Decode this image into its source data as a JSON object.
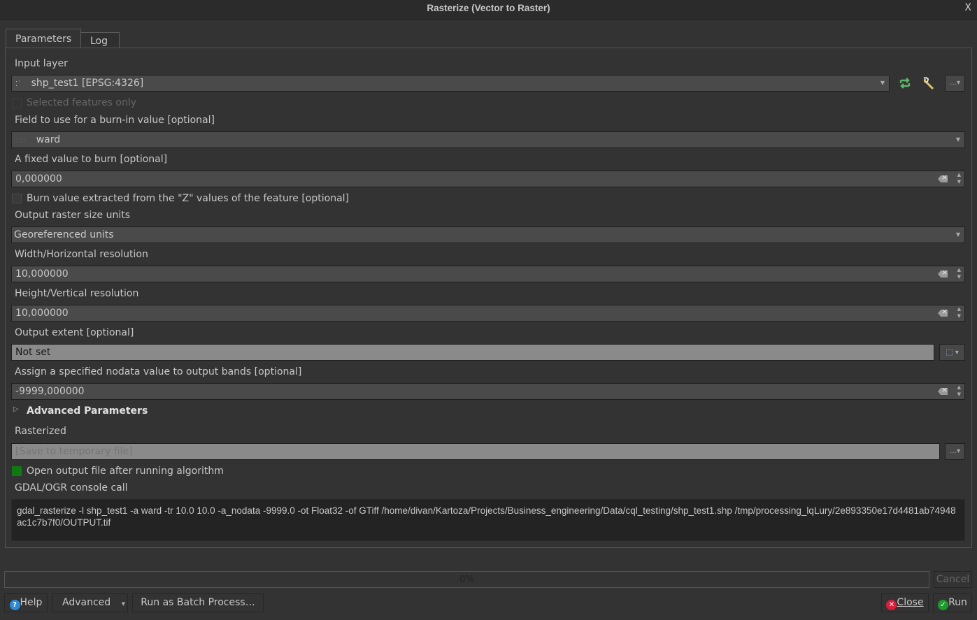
{
  "window": {
    "title": "Rasterize (Vector to Raster)",
    "close_label": "X"
  },
  "tabs": [
    {
      "label": "Parameters",
      "active": true
    },
    {
      "label": "Log",
      "active": false
    }
  ],
  "params": {
    "input_layer": {
      "label": "Input layer",
      "value": "shp_test1 [EPSG:4326]",
      "more_label": "…"
    },
    "selected_only": {
      "label": "Selected features only",
      "checked": false,
      "enabled": false
    },
    "burn_field": {
      "label": "Field to use for a burn-in value [optional]",
      "value": "ward",
      "type_badge": "123"
    },
    "fixed_value": {
      "label": "A fixed value to burn [optional]",
      "value": "0,000000"
    },
    "use_z": {
      "label": "Burn value extracted from the \"Z\" values of the feature [optional]",
      "checked": false
    },
    "units": {
      "label": "Output raster size units",
      "value": "Georeferenced units"
    },
    "width": {
      "label": "Width/Horizontal resolution",
      "value": "10,000000"
    },
    "height": {
      "label": "Height/Vertical resolution",
      "value": "10,000000"
    },
    "extent": {
      "label": "Output extent [optional]",
      "value": "Not set"
    },
    "nodata": {
      "label": "Assign a specified nodata value to output bands [optional]",
      "value": "-9999,000000"
    },
    "advanced": {
      "label": "Advanced Parameters"
    },
    "output": {
      "label": "Rasterized",
      "placeholder": "[Save to temporary file]",
      "more_label": "…"
    },
    "open_output": {
      "label": "Open output file after running algorithm",
      "checked": true
    },
    "console": {
      "label": "GDAL/OGR console call",
      "command": "gdal_rasterize -l shp_test1 -a ward -tr 10.0 10.0 -a_nodata -9999.0 -ot Float32 -of GTiff /home/divan/Kartoza/Projects/Business_engineering/Data/cql_testing/shp_test1.shp /tmp/processing_lqLury/2e893350e17d4481ab74948ac1c7b7f0/OUTPUT.tif"
    }
  },
  "progress": {
    "value_percent": 0,
    "text": "0%"
  },
  "buttons": {
    "cancel": "Cancel",
    "help": "Help",
    "advanced": "Advanced",
    "batch": "Run as Batch Process…",
    "close": "Close",
    "run": "Run"
  },
  "colors": {
    "accent_green": "#0f7a0f",
    "close_red": "#d81e3a",
    "run_green": "#1e9a2e",
    "help_blue": "#2b8ad8"
  }
}
